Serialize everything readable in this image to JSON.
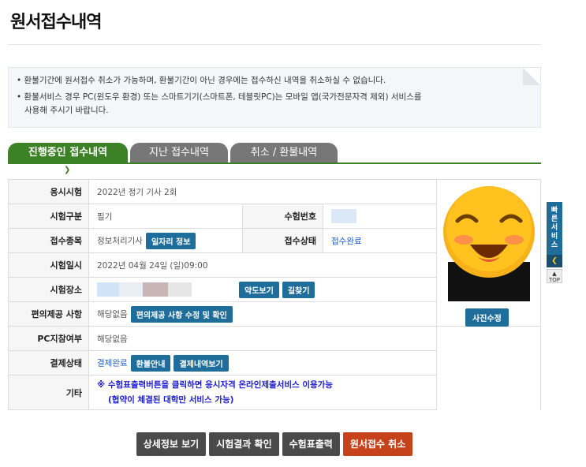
{
  "page_title": "원서접수내역",
  "notice": {
    "line1": "• 환불기간에 원서접수 취소가 가능하며, 환불기간이 아닌 경우에는 접수하신 내역을 취소하실 수 없습니다.",
    "line2a": "• 환불서비스 경우 PC(윈도우 환경) 또는 스마트기기(스마트폰, 테블릿PC)는 모바일 앱(국가전문자격 제외) 서비스를",
    "line2b": "사용해 주시기 바랍니다."
  },
  "tabs": [
    "진행중인 접수내역",
    "지난 접수내역",
    "취소 / 환불내역"
  ],
  "rows": {
    "exam_label": "응시시험",
    "exam_value": "2022년 정기 기사 2회",
    "type_label": "시험구분",
    "type_value": "필기",
    "number_label": "수험번호",
    "item_label": "접수종목",
    "item_value": "정보처리기사",
    "job_info_btn": "일자리 정보",
    "status_label": "접수상태",
    "status_value": "접수완료",
    "date_label": "시험일시",
    "date_value": "2022년 04월 24일 (일)09:00",
    "place_label": "시험장소",
    "map_btn": "약도보기",
    "route_btn": "길찾기",
    "conv_label": "편의제공 사항",
    "conv_value": "해당없음",
    "conv_btn": "편의제공 사항 수정 및 확인",
    "pc_label": "PC지참여부",
    "pc_value": "해당없음",
    "pay_label": "결제상태",
    "pay_value": "결제완료",
    "refund_btn": "환불안내",
    "pay_history_btn": "결제내역보기",
    "etc_label": "기타",
    "etc_line1": "※ 수험표출력버튼을 클릭하면 응시자격 온라인제출서비스 이용가능",
    "etc_line2": "(협약이 체결된 대학만 서비스 가능)",
    "photo_btn": "사진수정"
  },
  "bottom_buttons": [
    "상세정보 보기",
    "시험결과 확인",
    "수험표출력",
    "원서접수 취소"
  ],
  "side": {
    "quick": "빠른서비스",
    "top": "TOP"
  },
  "colors": {
    "tab_active": "#3d8127",
    "button_blue": "#1f6d9b",
    "cancel_orange": "#c6421a"
  }
}
